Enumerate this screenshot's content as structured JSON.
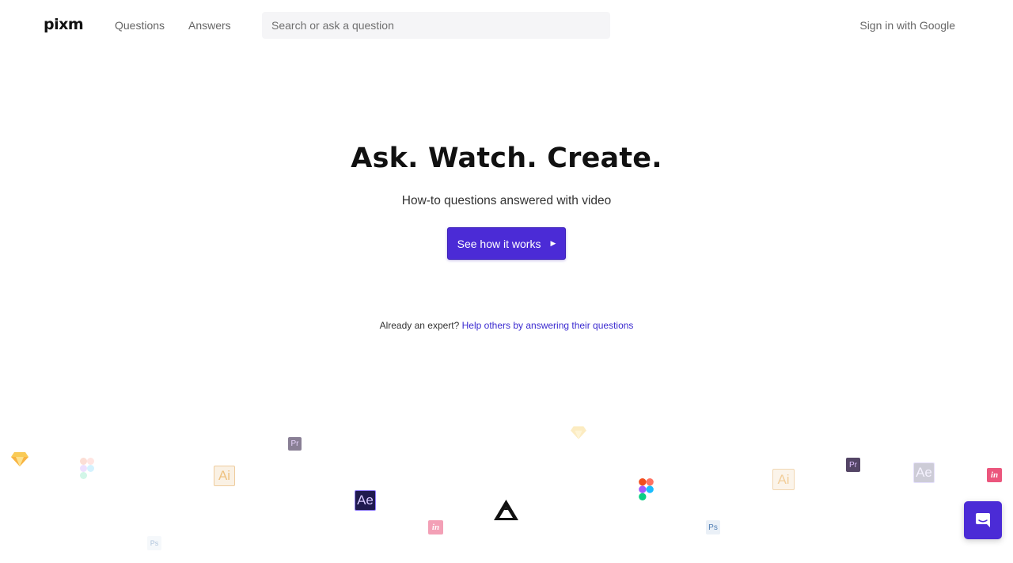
{
  "header": {
    "logo": "pixm",
    "nav": {
      "questions": "Questions",
      "answers": "Answers"
    },
    "search_placeholder": "Search or ask a question",
    "signin": "Sign in with Google"
  },
  "hero": {
    "title": "Ask. Watch. Create.",
    "subtitle": "How-to questions answered with video",
    "cta_label": "See how it works",
    "cta_icon": "play-triangle"
  },
  "expert": {
    "prefix": "Already an expert?",
    "link": "Help others by answering their questions"
  },
  "floating_icons": {
    "pr": "Pr",
    "ai": "Ai",
    "ae": "Ae",
    "ps": "Ps",
    "in": "in",
    "names": [
      "sketch-icon",
      "figma-icon",
      "illustrator-icon",
      "premiere-icon",
      "after-effects-icon",
      "invision-icon",
      "affinity-icon",
      "photoshop-icon"
    ]
  },
  "colors": {
    "accent": "#4b2bd6",
    "link": "#3b2bd0"
  },
  "chat": {
    "icon": "chat-bubble-icon"
  }
}
